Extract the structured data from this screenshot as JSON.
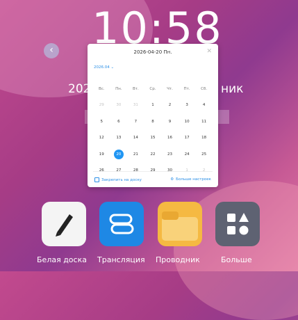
{
  "clock": {
    "time": "10:58"
  },
  "lock": {
    "date_left": "202",
    "date_right": "ник"
  },
  "calendar": {
    "header": "2026-04-20  Пн.",
    "month": "2026.04 ⌄",
    "weekdays": [
      "Вс.",
      "Пн.",
      "Вт.",
      "Ср.",
      "Чт.",
      "Пт.",
      "Сб."
    ],
    "weeks": [
      [
        "29",
        "30",
        "31",
        "1",
        "2",
        "3",
        "4"
      ],
      [
        "5",
        "6",
        "7",
        "8",
        "9",
        "10",
        "11"
      ],
      [
        "12",
        "13",
        "14",
        "15",
        "16",
        "17",
        "18"
      ],
      [
        "19",
        "20",
        "21",
        "22",
        "23",
        "24",
        "25"
      ],
      [
        "26",
        "27",
        "28",
        "29",
        "30",
        "1",
        "2"
      ]
    ],
    "selected": "20",
    "footer_left": "Закрепить на доску",
    "footer_right": "Больше настроек"
  },
  "dock": [
    {
      "label": "Белая доска",
      "icon": "pen-icon"
    },
    {
      "label": "Трансляция",
      "icon": "cast-icon"
    },
    {
      "label": "Проводник",
      "icon": "folder-icon"
    },
    {
      "label": "Больше",
      "icon": "apps-icon"
    }
  ],
  "colors": {
    "accent": "#2196f3",
    "folder": "#f5b942",
    "cast": "#1e88e5"
  }
}
